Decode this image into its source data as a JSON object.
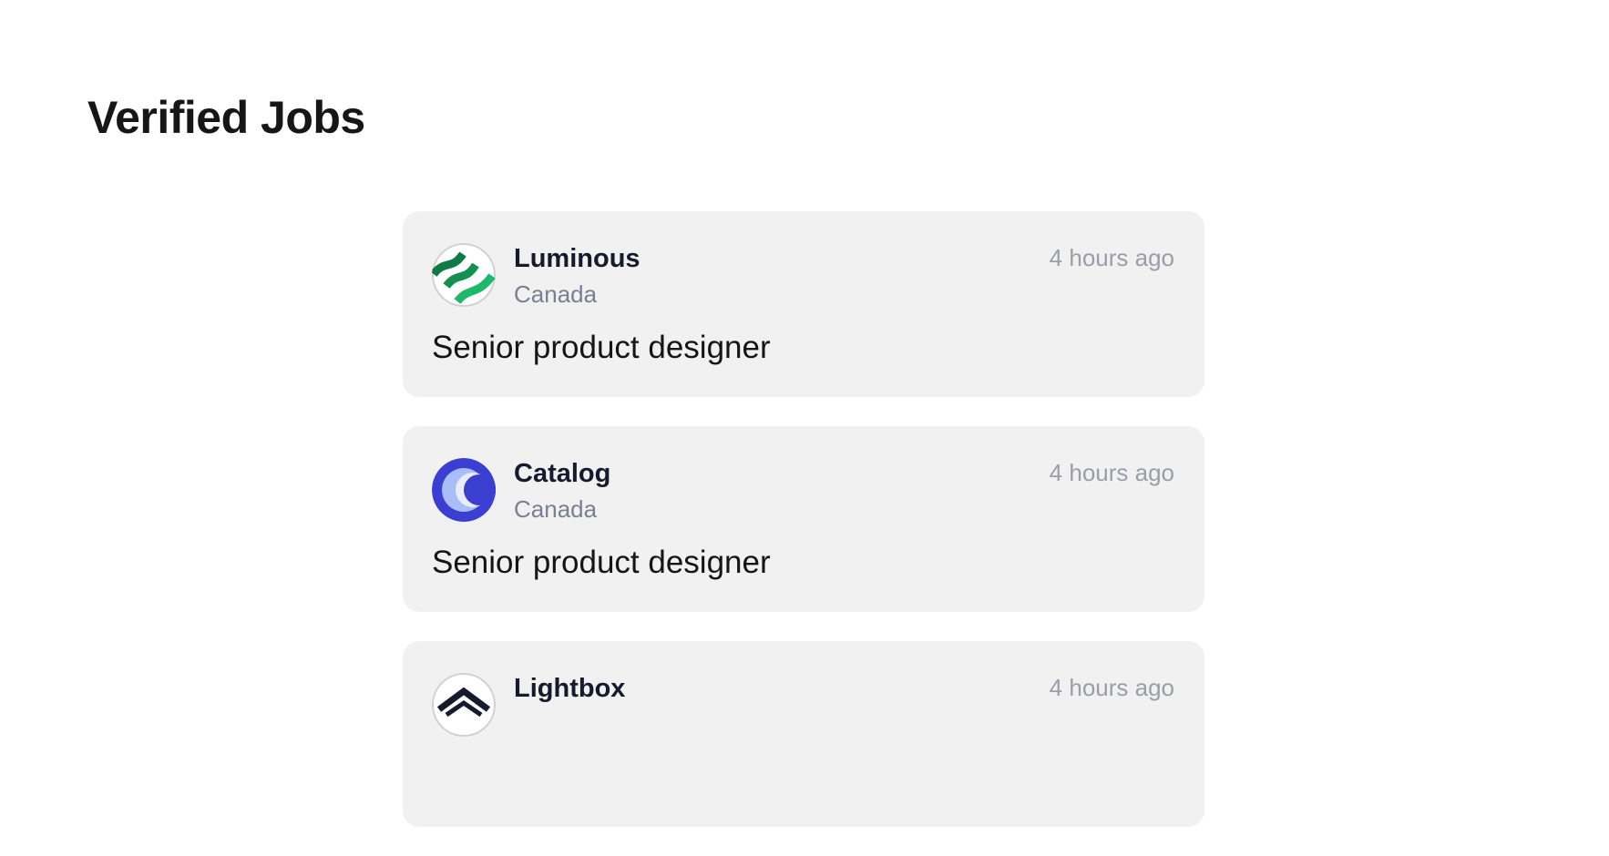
{
  "page": {
    "title": "Verified Jobs"
  },
  "jobs": [
    {
      "company": "Luminous",
      "location": "Canada",
      "posted": "4 hours ago",
      "title": "Senior product designer",
      "logo_icon": "luminous-logo-icon"
    },
    {
      "company": "Catalog",
      "location": "Canada",
      "posted": "4 hours ago",
      "title": "Senior product designer",
      "logo_icon": "catalog-logo-icon"
    },
    {
      "company": "Lightbox",
      "location": "",
      "posted": "4 hours ago",
      "title": "",
      "logo_icon": "lightbox-logo-icon"
    }
  ],
  "colors": {
    "card_background": "#f1f1f1",
    "company_name": "#151a2d",
    "location": "#7a8091",
    "posted_time": "#9a9ea8",
    "luminous_green_dark": "#0f7a45",
    "luminous_green_light": "#1fb86a",
    "catalog_blue": "#3b3fd1",
    "catalog_light_blue": "#a9bdf6",
    "lightbox_navy": "#151a2d"
  }
}
